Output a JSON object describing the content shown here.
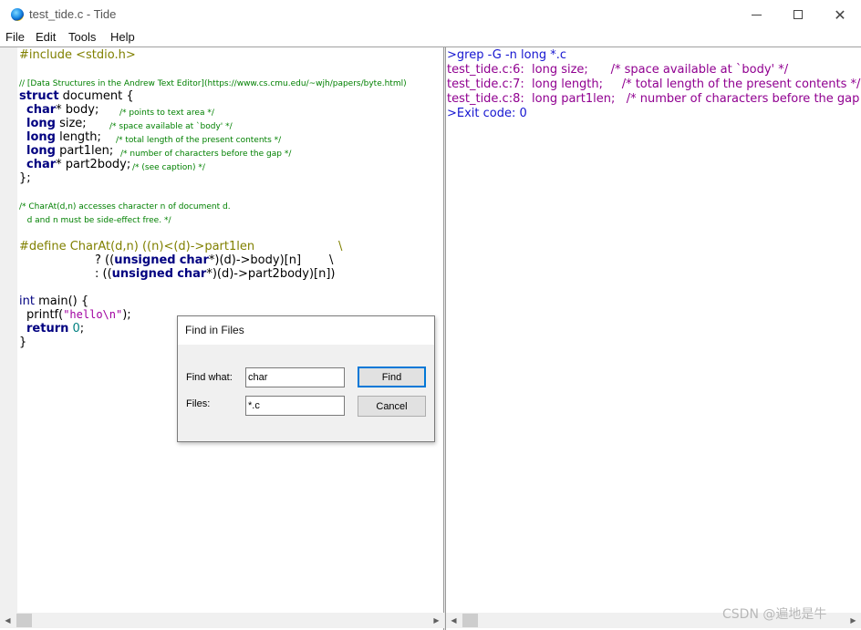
{
  "window": {
    "title": "test_tide.c - Tide",
    "minimize_icon": "minimize-icon",
    "maximize_icon": "maximize-icon",
    "close_icon": "close-icon"
  },
  "menu": {
    "file": "File",
    "edit": "Edit",
    "tools": "Tools",
    "help": "Help"
  },
  "editor": {
    "include": "#include <stdio.h>",
    "comment_link": "// [Data Structures in the Andrew Text Editor](https://www.cs.cmu.edu/~wjh/papers/byte.html)",
    "struct_kw": "struct",
    "struct_name": " document {",
    "m1_type": "char",
    "m1_rest": "* body;",
    "m1_comment": "/* points to text area */",
    "m2_type": "long",
    "m2_rest": " size;",
    "m2_comment": "/* space available at `body' */",
    "m3_type": "long",
    "m3_rest": " length;",
    "m3_comment": "/* total length of the present contents */",
    "m4_type": "long",
    "m4_rest": " part1len;",
    "m4_comment": "/* number of characters before the gap */",
    "m5_type": "char",
    "m5_rest": "* part2body;",
    "m5_comment": "/* (see caption) */",
    "struct_close": "};",
    "charat_comment_1": "/* CharAt(d,n) accesses character n of document d.",
    "charat_comment_2": "   d and n must be side-effect free. */",
    "define_line": "#define CharAt(d,n) ((n)<(d)->part1len",
    "define_backslash_1": "\\",
    "define_l2_pre": "? ((",
    "define_l2_kw1": "unsigned",
    "define_l2_kw2": "char",
    "define_l2_post": "*)(d)->body)[n]",
    "define_backslash_2": "\\",
    "define_l3_pre": ": ((",
    "define_l3_kw1": "unsigned",
    "define_l3_kw2": "char",
    "define_l3_post": "*)(d)->part2body)[n])",
    "main_kw": "int",
    "main_rest": " main() {",
    "printf_pre": "printf(",
    "printf_str": "\"hello\\n\"",
    "printf_post": ");",
    "return_kw": "return",
    "return_num": "0",
    "return_post": ";",
    "main_close": "}"
  },
  "output": {
    "lines": [
      {
        "text": ">grep -G -n long *.c",
        "color": "#1515d0"
      },
      {
        "file": "test_tide.c:6:",
        "code": "  long size;",
        "comment": "      /* space available at `body' */"
      },
      {
        "file": "test_tide.c:7:",
        "code": "  long length;",
        "comment": "     /* total length of the present contents */"
      },
      {
        "file": "test_tide.c:8:",
        "code": "  long part1len;",
        "comment": "   /* number of characters before the gap */"
      },
      {
        "text": ">Exit code: 0",
        "color": "#1515d0"
      }
    ]
  },
  "dialog": {
    "title": "Find in Files",
    "find_what_label": "Find what:",
    "find_what_value": "char",
    "files_label": "Files:",
    "files_value": "*.c",
    "find_button": "Find",
    "cancel_button": "Cancel"
  },
  "watermark": "CSDN @遍地是牛"
}
